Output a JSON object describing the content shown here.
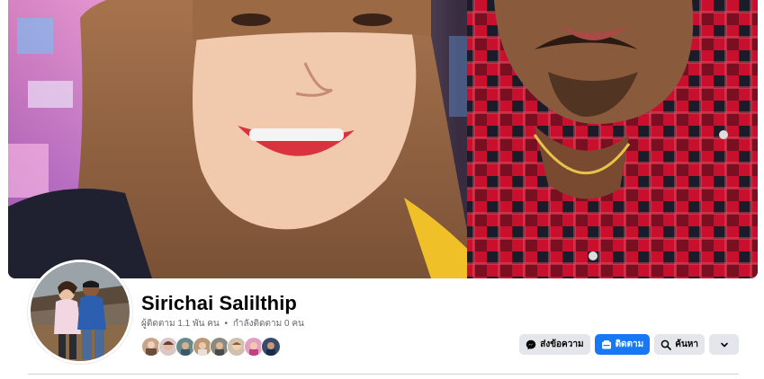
{
  "profile": {
    "name": "Sirichai Salilthip",
    "followers_text": "ผู้ติดตาม 1.1 พัน คน",
    "separator": "•",
    "following_text": "กำลังติดตาม 0 คน"
  },
  "actions": {
    "message_label": "ส่งข้อความ",
    "follow_label": "ติดตาม",
    "search_label": "ค้นหา"
  },
  "friend_avatars": [
    "friend-avatar-1",
    "friend-avatar-2",
    "friend-avatar-3",
    "friend-avatar-4",
    "friend-avatar-5",
    "friend-avatar-6",
    "friend-avatar-7",
    "friend-avatar-8"
  ],
  "colors": {
    "primary_button": "#1877f2",
    "secondary_button": "#e4e6eb",
    "secondary_text": "#65676b"
  },
  "icons": {
    "message": "messenger-icon",
    "follow": "follow-icon",
    "search": "search-icon",
    "more": "chevron-down-icon"
  }
}
